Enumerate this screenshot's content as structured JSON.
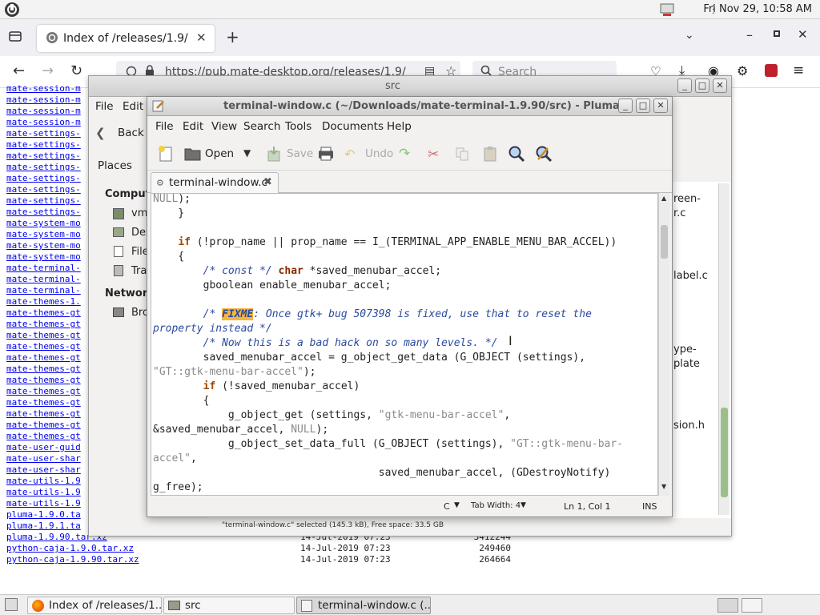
{
  "top_panel": {
    "clock": "Fri Nov 29, 10:58 AM"
  },
  "firefox": {
    "tab_title": "Index of /releases/1.9/",
    "url": "https://pub.mate-desktop.org/releases/1.9/",
    "search_placeholder": "Search"
  },
  "listing": {
    "left_names": [
      "mate-session-m",
      "mate-session-m",
      "mate-session-m",
      "mate-session-m",
      "mate-settings-",
      "mate-settings-",
      "mate-settings-",
      "mate-settings-",
      "mate-settings-",
      "mate-settings-",
      "mate-settings-",
      "mate-settings-",
      "mate-system-mo",
      "mate-system-mo",
      "mate-system-mo",
      "mate-system-mo",
      "mate-terminal-",
      "mate-terminal-",
      "mate-terminal-",
      "mate-themes-1.",
      "mate-themes-gt",
      "mate-themes-gt",
      "mate-themes-gt",
      "mate-themes-gt",
      "mate-themes-gt",
      "mate-themes-gt",
      "mate-themes-gt",
      "mate-themes-gt",
      "mate-themes-gt",
      "mate-themes-gt",
      "mate-themes-gt",
      "mate-themes-gt",
      "mate-user-guid",
      "mate-user-shar",
      "mate-user-shar",
      "mate-utils-1.9",
      "mate-utils-1.9",
      "mate-utils-1.9",
      "pluma-1.9.0.ta",
      "pluma-1.9.1.ta"
    ],
    "rows": [
      {
        "name": "pluma-1.9.90.tar.xz",
        "date": "14-Jul-2019 07:23",
        "size": "3412244"
      },
      {
        "name": "python-caja-1.9.0.tar.xz",
        "date": "14-Jul-2019 07:23",
        "size": "249460"
      },
      {
        "name": "python-caja-1.9.90.tar.xz",
        "date": "14-Jul-2019 07:23",
        "size": "264664"
      }
    ]
  },
  "caja": {
    "title": "src",
    "menu": {
      "file": "File",
      "edit": "Edit"
    },
    "back": "Back",
    "places": "Places",
    "computer_header": "Computer",
    "computer_label": "Comput",
    "network_label": "Network",
    "side_items": [
      "vm",
      "Des",
      "File",
      "Tra"
    ],
    "network_items": [
      "Bro"
    ],
    "file_fragments": [
      "reen-",
      "r.c",
      "label.c",
      "ype-",
      "plate",
      "sion.h"
    ],
    "status": "\"terminal-window.c\" selected (145.3 kB), Free space: 33.5 GB"
  },
  "pluma": {
    "title": "terminal-window.c (~/Downloads/mate-terminal-1.9.90/src) - Pluma",
    "menus": [
      "File",
      "Edit",
      "View",
      "Search",
      "Tools",
      "Documents",
      "Help"
    ],
    "toolbar": {
      "open": "Open",
      "save": "Save",
      "undo": "Undo"
    },
    "tab_label": "terminal-window.c",
    "status": {
      "language": "C",
      "tab_width": "Tab Width:  4",
      "position": "Ln 1, Col 1",
      "mode": "INS"
    }
  },
  "taskbar": [
    {
      "label": "Index of /releases/1...."
    },
    {
      "label": "src"
    },
    {
      "label": "terminal-window.c (..."
    }
  ]
}
